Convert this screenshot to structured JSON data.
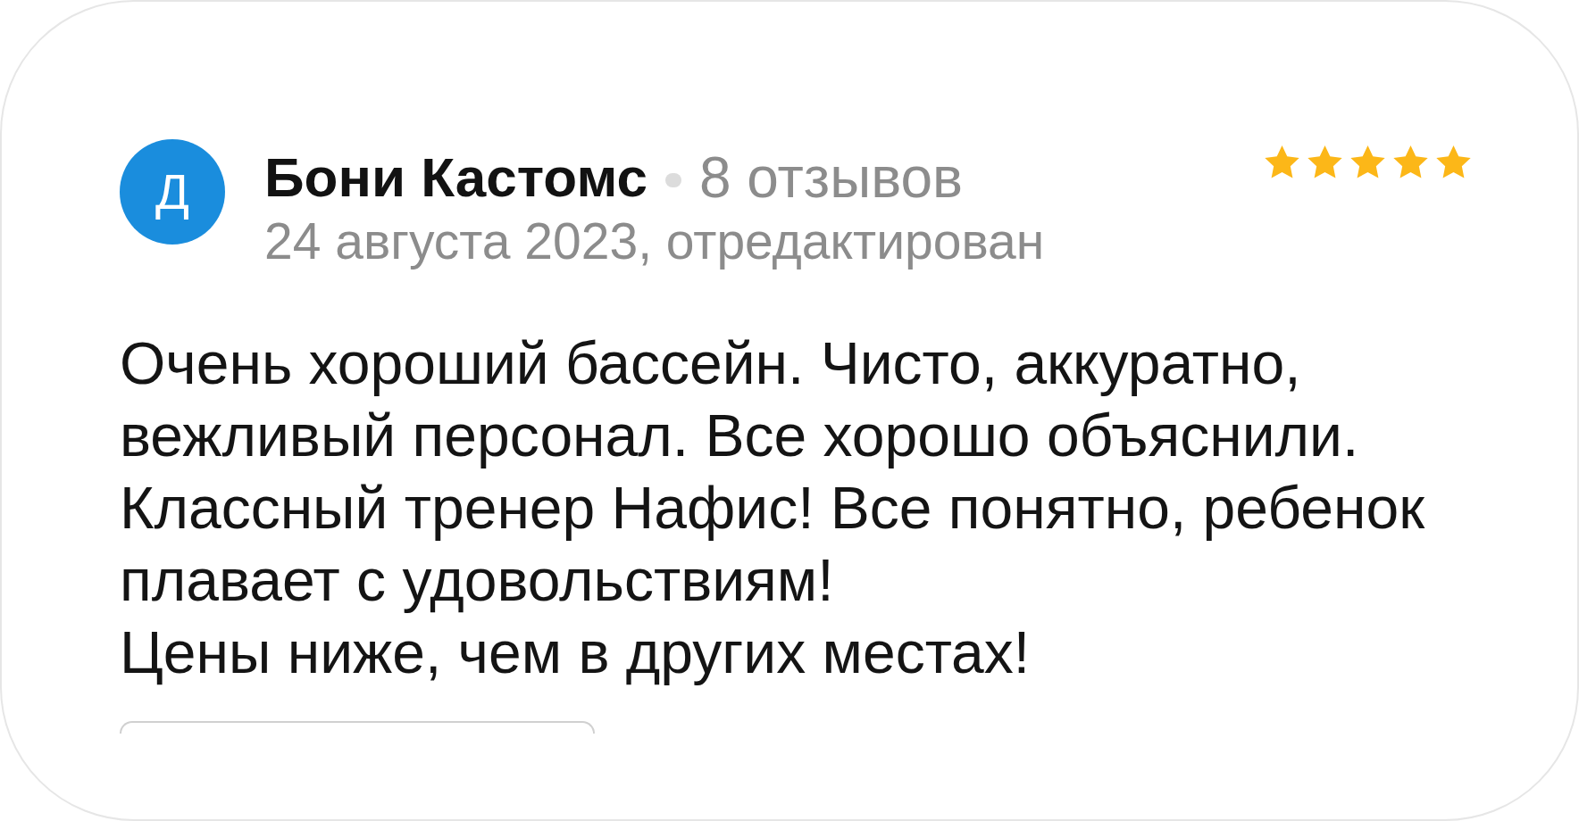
{
  "review": {
    "author": {
      "initial": "Д",
      "name": "Бони Кастомс",
      "reviews_count": "8 отзывов"
    },
    "date": "24 августа 2023, отредактирован",
    "stars": 5,
    "paragraphs": [
      "Очень хороший бассейн. Чисто, аккуратно, вежливый персонал. Все хорошо объяснили. Классный тренер Нафис! Все понятно, ребенок плавает с удовольствиям!",
      "Цены ниже, чем в других местах!"
    ]
  }
}
